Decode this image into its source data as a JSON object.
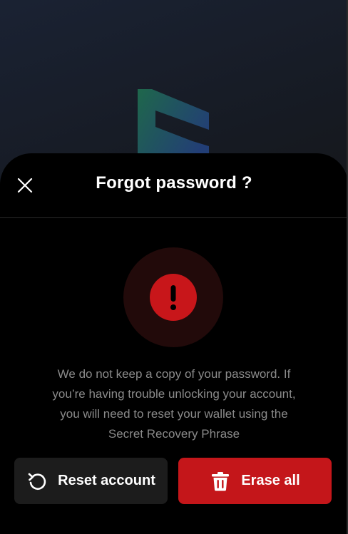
{
  "background": {
    "logo_icon": "brand-logo-icon",
    "colors": {
      "logo_green": "#1f6b4d",
      "logo_blue": "#23407a"
    }
  },
  "dialog": {
    "title": "Forgot password ?",
    "close_icon": "close-icon",
    "warning_icon": "exclamation-circle-icon",
    "message_lines": [
      "We do not keep a copy of your password. If",
      "you’re having trouble unlocking your account,",
      "you will need to reset your wallet using the",
      "Secret Recovery Phrase"
    ],
    "buttons": {
      "reset": {
        "label": "Reset account",
        "icon": "reset-icon"
      },
      "erase": {
        "label": "Erase all",
        "icon": "trash-icon"
      }
    },
    "colors": {
      "accent_red": "#c4161a",
      "sheet_bg": "#000000",
      "muted_text": "#8a8a8a"
    }
  }
}
